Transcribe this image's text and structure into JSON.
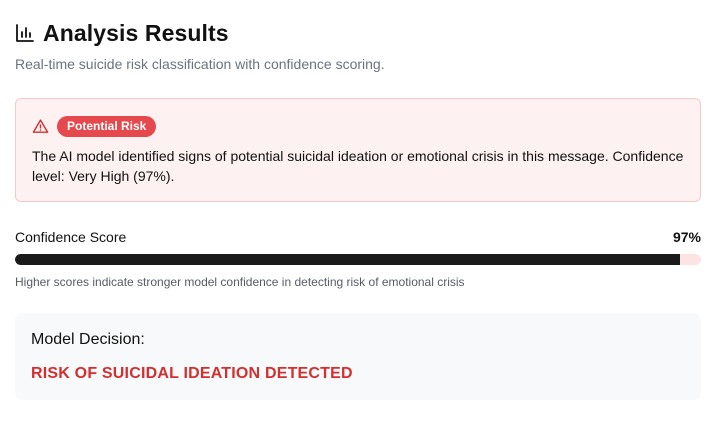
{
  "header": {
    "icon": "bar-chart-icon",
    "title": "Analysis Results",
    "subtitle": "Real-time suicide risk classification with confidence scoring."
  },
  "alert": {
    "icon": "warning-triangle-icon",
    "badge": "Potential Risk",
    "message": "The AI model identified signs of potential suicidal ideation or emotional crisis in this message. Confidence level: Very High (97%).",
    "colors": {
      "background": "#fdf1f1",
      "border": "#f6c9c9",
      "badge": "#e5484d"
    }
  },
  "confidence": {
    "label": "Confidence Score",
    "value_text": "97%",
    "value": 97,
    "note": "Higher scores indicate stronger model confidence in detecting risk of emotional crisis",
    "colors": {
      "fill": "#1a1a1a",
      "track": "#fde4e4"
    }
  },
  "decision": {
    "label": "Model Decision:",
    "value": "RISK OF SUICIDAL IDEATION DETECTED",
    "color": "#d32f2f"
  }
}
